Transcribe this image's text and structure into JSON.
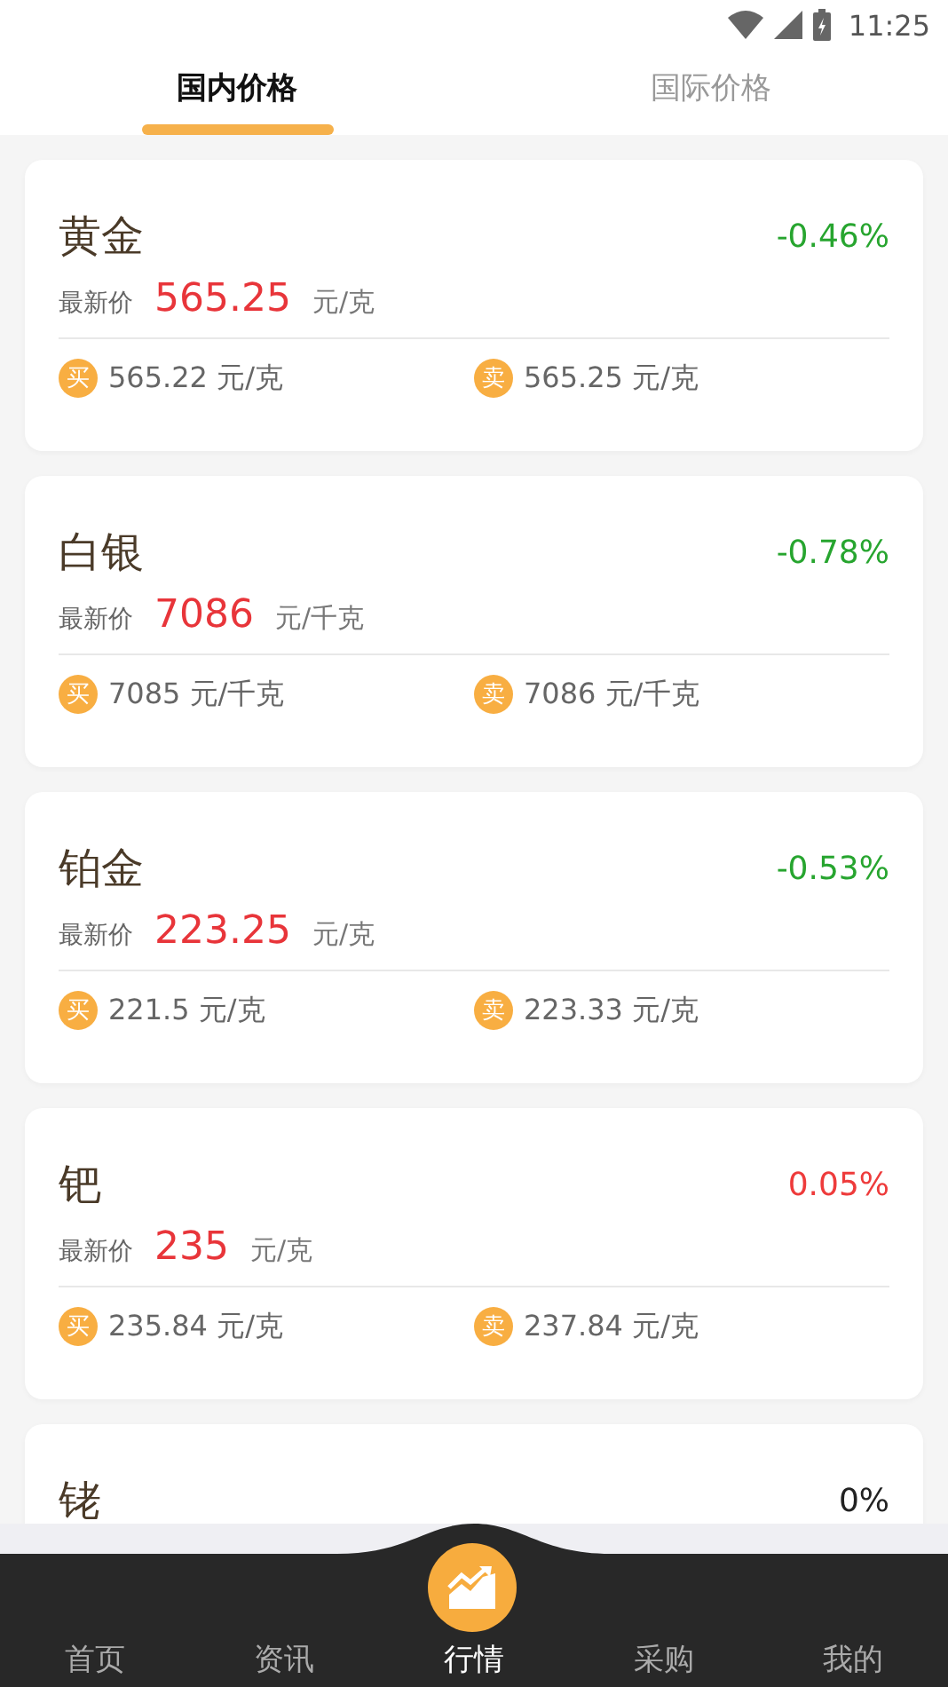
{
  "status_bar": {
    "time": "11:25"
  },
  "tabs": [
    {
      "label": "国内价格",
      "selected": true
    },
    {
      "label": "国际价格",
      "selected": false
    }
  ],
  "metals": [
    {
      "name": "黄金",
      "change": "-0.46%",
      "color": "#27a52f",
      "latest_label": "最新价",
      "latest": "565.25",
      "unit": "元/克",
      "buy_badge": "买",
      "buy": "565.22 元/克",
      "sell_badge": "卖",
      "sell": "565.25 元/克"
    },
    {
      "name": "白银",
      "change": "-0.78%",
      "color": "#27a52f",
      "latest_label": "最新价",
      "latest": "7086",
      "unit": "元/千克",
      "buy_badge": "买",
      "buy": "7085 元/千克",
      "sell_badge": "卖",
      "sell": "7086 元/千克"
    },
    {
      "name": "铂金",
      "change": "-0.53%",
      "color": "#27a52f",
      "latest_label": "最新价",
      "latest": "223.25",
      "unit": "元/克",
      "buy_badge": "买",
      "buy": "221.5 元/克",
      "sell_badge": "卖",
      "sell": "223.33 元/克"
    },
    {
      "name": "钯",
      "change": "0.05%",
      "color": "#ee3b3b",
      "latest_label": "最新价",
      "latest": "235",
      "unit": "元/克",
      "buy_badge": "买",
      "buy": "235.84 元/克",
      "sell_badge": "卖",
      "sell": "237.84 元/克"
    },
    {
      "name": "铑",
      "change": "0%",
      "color": "#222222"
    }
  ],
  "nav": [
    {
      "label": "首页",
      "selected": false
    },
    {
      "label": "资讯",
      "selected": false
    },
    {
      "label": "行情",
      "selected": true
    },
    {
      "label": "采购",
      "selected": false
    },
    {
      "label": "我的",
      "selected": false
    }
  ]
}
